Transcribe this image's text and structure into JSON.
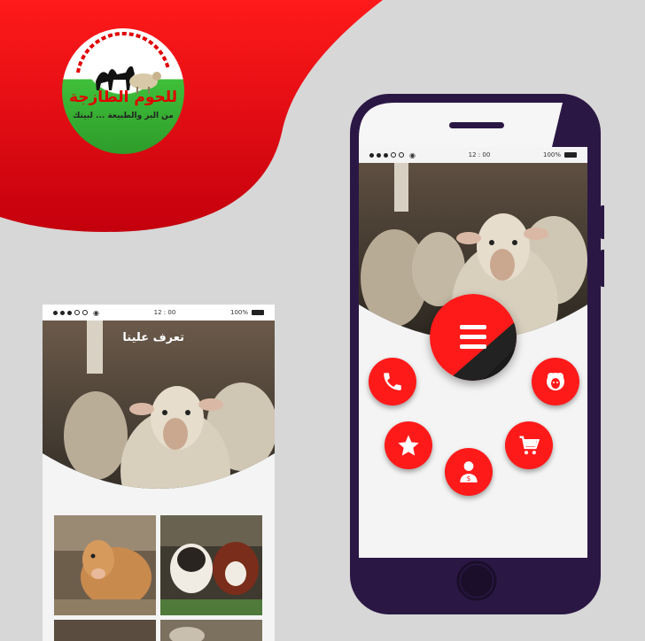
{
  "colors": {
    "brand_red": "#e3000f",
    "phone_frame": "#2b1744",
    "button_red": "#ff1a1a",
    "background": "#d7d7d7"
  },
  "logo": {
    "line1": "للحوم الطازجة",
    "line2": "من البر والطبيعة ... لبيتك",
    "icon": "camel-sheep-logo"
  },
  "small_phone": {
    "status": {
      "time": "12 : 00",
      "battery": "100%"
    },
    "hero_title": "تعرف علينا"
  },
  "big_phone": {
    "status": {
      "time": "12 : 00",
      "battery": "100%"
    },
    "menu_icon": "hamburger-menu-icon",
    "buttons": [
      {
        "name": "call",
        "icon": "phone-icon"
      },
      {
        "name": "sheep",
        "icon": "sheep-face-icon"
      },
      {
        "name": "favorites",
        "icon": "star-icon"
      },
      {
        "name": "cart",
        "icon": "shopping-cart-icon"
      },
      {
        "name": "account",
        "icon": "user-money-icon"
      }
    ]
  }
}
